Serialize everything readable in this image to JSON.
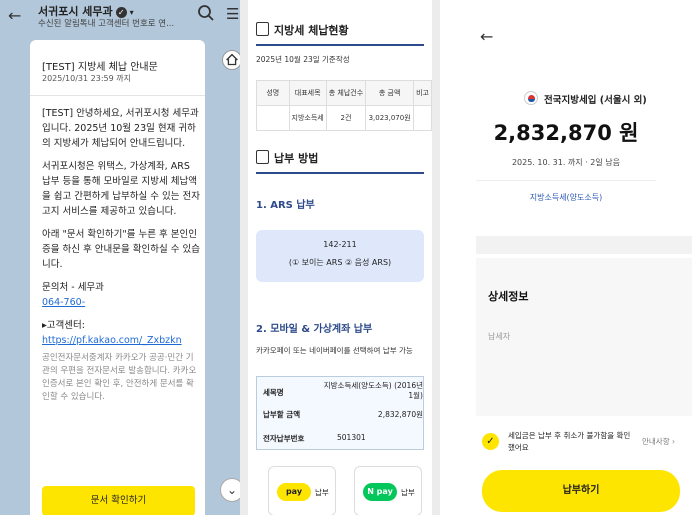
{
  "chat": {
    "title": "서귀포시 세무과",
    "subtitle": "수신된 알림톡내 고객센터 번호로 연...",
    "message": {
      "title": "[TEST] 지방세 체납 안내문",
      "date": "2025/10/31 23:59 까지",
      "paragraphs": [
        "[TEST] 안녕하세요, 서귀포시청 세무과입니다. 2025년 10월 23일 현재 귀하의 지방세가 체납되어 안내드립니다.",
        "서귀포시청은 위택스, 가상계좌, ARS 납부 등을 통해 모바일로 지방세 체납액을 쉽고 간편하게 납부하실 수 있는 전자고지 서비스를 제공하고 있습니다.",
        "아래 \"문서 확인하기\"를 누른 후 본인인증을 하신 후 안내문을 확인하실 수 있습니다."
      ],
      "contact_label": "문의처 - 세무과",
      "contact_phone": "064-760-",
      "center_label": "▸고객센터:",
      "center_link": "https://pf.kakao.com/_Zxbzkn",
      "notice": "공인전자문서중계자 카카오가 공공·민간 기관의 우편을 전자문서로 발송합니다. 카카오 인증서로 본인 확인 후, 안전하게 문서를 확인할 수 있습니다.",
      "button": "문서 확인하기"
    }
  },
  "status": {
    "title": "지방세 체납현황",
    "basis": "2025년 10월 23일 기준작성",
    "table": {
      "headers": [
        "성명",
        "대표세목",
        "총 체납건수",
        "총 금액",
        "비고"
      ],
      "row": [
        "",
        "지방소득세",
        "2건",
        "3,023,070원",
        ""
      ]
    },
    "method_title": "납부 방법",
    "ars_title": "1. ARS 납부",
    "ars_number": "142-211",
    "ars_options": "(① 보이는 ARS ② 음성 ARS)",
    "mobile_title": "2. 모바일 & 가상계좌 납부",
    "mobile_desc": "카카오페이 또는 네이버페이를 선택하여 납부 가능",
    "info": [
      {
        "key": "세목명",
        "value": "지방소득세(양도소득) (2016년 1월)"
      },
      {
        "key": "납부할 금액",
        "value": "2,832,870원"
      },
      {
        "key": "전자납부번호",
        "value": "501301"
      }
    ],
    "pay_options": [
      {
        "badge": "pay",
        "label": "납부",
        "color": "#fee500",
        "text_color": "#222"
      },
      {
        "badge": "N pay",
        "label": "납부",
        "color": "#03c75a",
        "text_color": "#fff"
      }
    ]
  },
  "confirm": {
    "title": "전국지방세입 (서울시 외)",
    "amount": "2,832,870 원",
    "due": "2025. 10. 31. 까지 · 2일 남음",
    "item": "지방소득세(양도소득)",
    "detail_title": "상세정보",
    "payer_label": "납세자",
    "agree_text": "세입금은 납부 후 취소가 불가함을 확인했어요",
    "guide": "안내사항 ›",
    "pay_button": "납부하기"
  }
}
